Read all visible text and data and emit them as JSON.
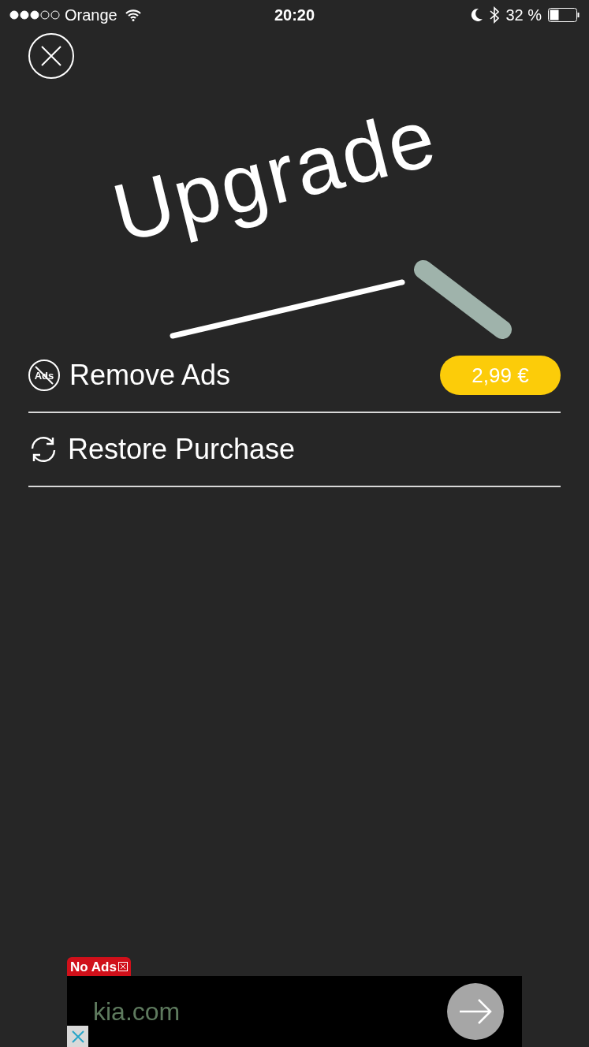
{
  "status_bar": {
    "carrier": "Orange",
    "time": "20:20",
    "battery": "32 %"
  },
  "title": "Upgrade",
  "items": [
    {
      "kind": "remove_ads",
      "icon_text": "Ads",
      "label": "Remove Ads",
      "price": "2,99 €"
    },
    {
      "kind": "restore",
      "label": "Restore Purchase"
    }
  ],
  "ad": {
    "badge": "No Ads",
    "domain": "kia.com"
  }
}
